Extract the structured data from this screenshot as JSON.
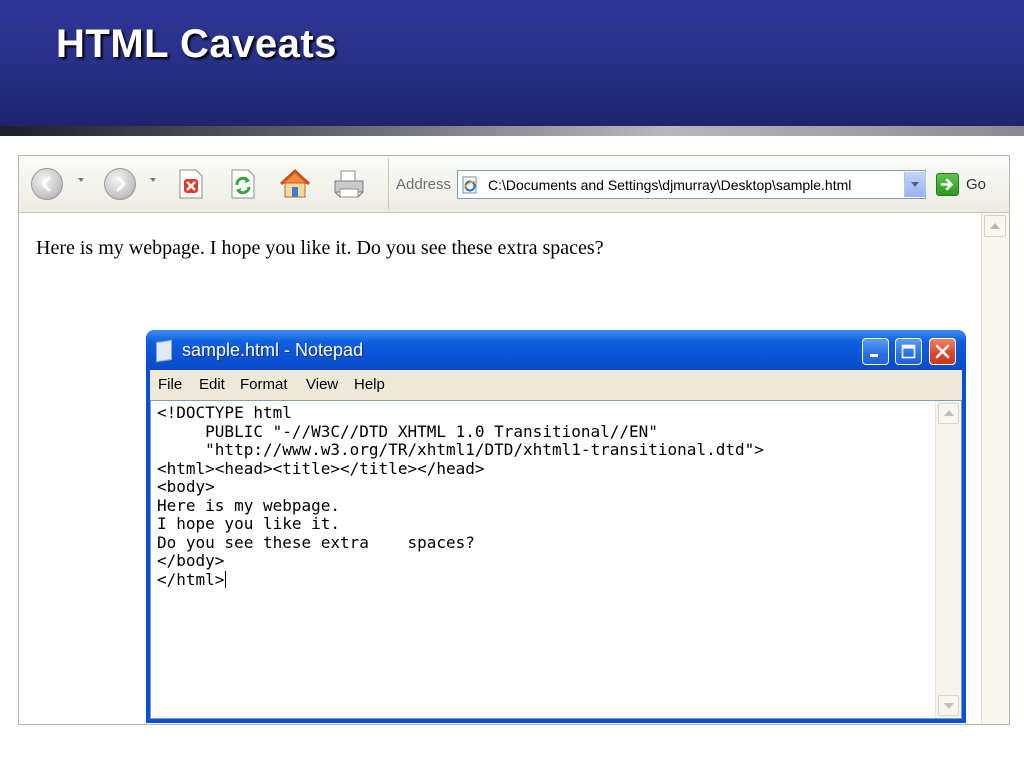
{
  "slide": {
    "title": "HTML Caveats",
    "header_color": "#283189"
  },
  "browser": {
    "toolbar": {
      "back_icon": "back-arrow-icon",
      "forward_icon": "forward-arrow-icon",
      "stop_icon": "stop-icon",
      "refresh_icon": "refresh-icon",
      "home_icon": "home-icon",
      "print_icon": "printer-icon"
    },
    "address": {
      "label": "Address",
      "value": "C:\\Documents and Settings\\djmurray\\Desktop\\sample.html",
      "page_icon": "ie-page-icon"
    },
    "go_label": "Go",
    "page_text": "Here is my webpage. I hope you like it. Do you see these extra spaces?"
  },
  "notepad": {
    "title": "sample.html - Notepad",
    "menu": [
      "File",
      "Edit",
      "Format",
      "View",
      "Help"
    ],
    "content": "<!DOCTYPE html\n     PUBLIC \"-//W3C//DTD XHTML 1.0 Transitional//EN\"\n     \"http://www.w3.org/TR/xhtml1/DTD/xhtml1-transitional.dtd\">\n<html><head><title></title></head>\n<body>\nHere is my webpage.\nI hope you like it.\nDo you see these extra    spaces?\n</body>\n</html>",
    "window_controls": [
      "minimize-icon",
      "maximize-icon",
      "close-icon"
    ],
    "titlebar_color": "#0a52d4"
  }
}
